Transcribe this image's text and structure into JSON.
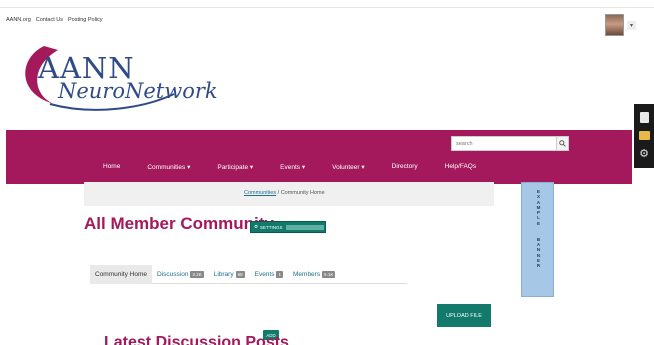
{
  "top_links": [
    "AANN.org",
    "Contact Us",
    "Posting Policy"
  ],
  "logo": {
    "main": "AANN",
    "sub": "NeuroNetwork"
  },
  "search": {
    "placeholder": "search"
  },
  "nav": {
    "items": [
      "Home",
      "Communities",
      "Participate",
      "Events",
      "Volunteer",
      "Directory",
      "Help/FAQs"
    ],
    "dropdown_marker": "▾"
  },
  "breadcrumb": {
    "link": "Communities",
    "separator": "/",
    "current": "Community Home"
  },
  "page": {
    "title": "All Member Community",
    "settings_label": "SETTINGS"
  },
  "banner": {
    "text": "EXAMPLE  BANNER"
  },
  "tabs": [
    {
      "label": "Community Home",
      "badge": ""
    },
    {
      "label": "Discussion",
      "badge": "2.2K"
    },
    {
      "label": "Library",
      "badge": "68"
    },
    {
      "label": "Events",
      "badge": "1"
    },
    {
      "label": "Members",
      "badge": "5.1K"
    }
  ],
  "upload_label": "UPLOAD FILE",
  "latest": {
    "title": "Latest Discussion Posts",
    "add_label": "ADD"
  },
  "icons": [
    "search-icon",
    "gear-icon",
    "document-icon",
    "folder-icon",
    "user-avatar"
  ],
  "colors": {
    "brand": "#a3195b",
    "accent": "#117a6a",
    "link": "#1d6f8f",
    "logo": "#2e4a87"
  }
}
